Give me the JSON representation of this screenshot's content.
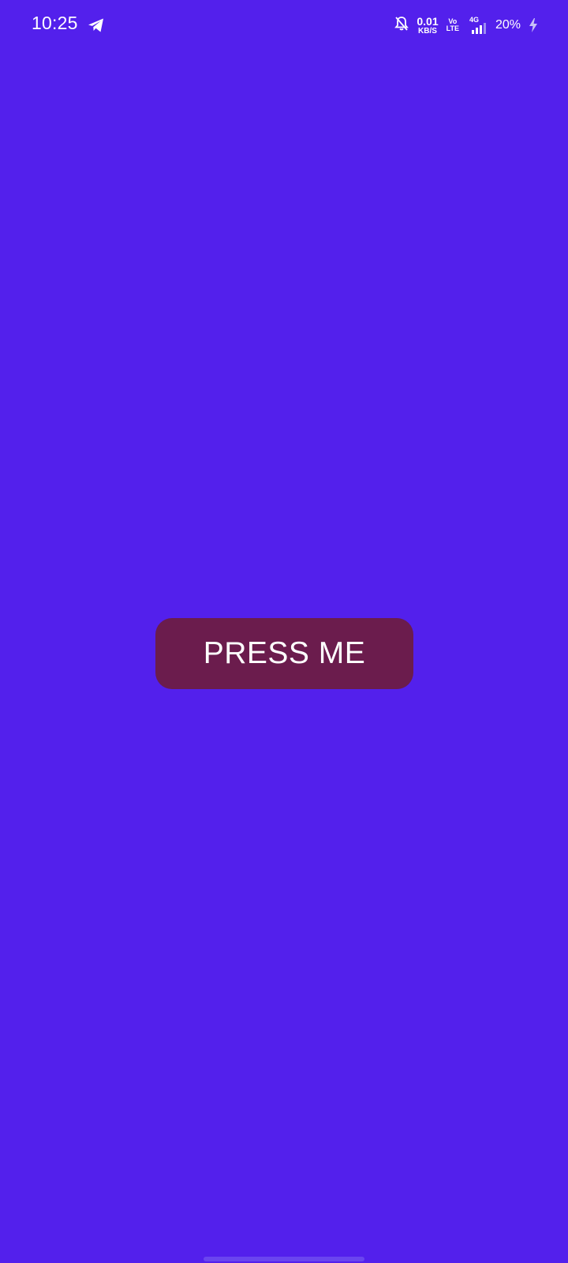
{
  "status_bar": {
    "time": "10:25",
    "net_speed_value": "0.01",
    "net_speed_unit": "KB/S",
    "volte_top": "Vo",
    "volte_bottom": "LTE",
    "network_type": "4G",
    "battery_percent": "20%",
    "icons": [
      "telegram-icon",
      "bell-off-icon",
      "signal-icon",
      "charging-bolt-icon"
    ]
  },
  "main": {
    "button_label": "PRESS ME"
  },
  "colors": {
    "background": "#5320ec",
    "button": "#6b1c4d",
    "text": "#ffffff"
  }
}
